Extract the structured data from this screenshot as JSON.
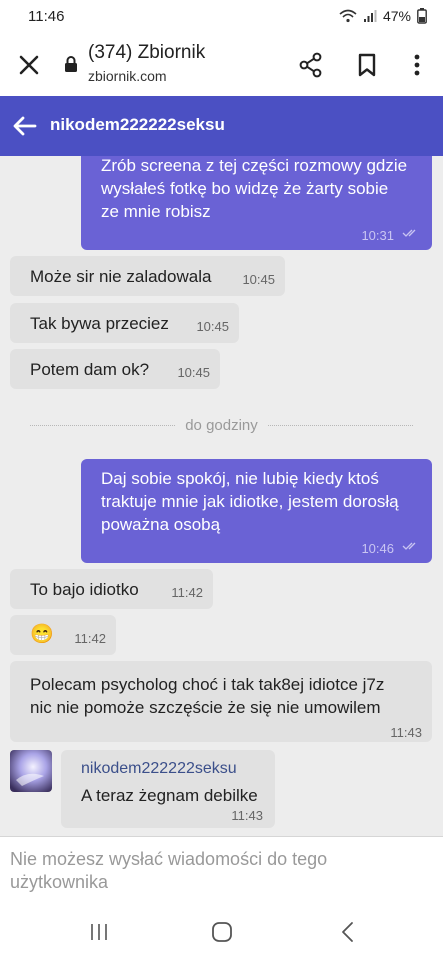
{
  "status_bar": {
    "time": "11:46",
    "battery": "47%"
  },
  "browser": {
    "tab_title": "(374) Zbiornik",
    "url": "zbiornik.com"
  },
  "chat": {
    "contact_name": "nikodem222222seksu"
  },
  "messages": [
    {
      "dir": "out",
      "lines": [
        "Zrób screena z tej części rozmowy gdzie",
        "wysłałeś fotkę bo widzę że żarty sobie",
        "ze mnie robisz"
      ],
      "time": "10:31"
    },
    {
      "dir": "in",
      "text": "Może sir nie zaladowala",
      "time": "10:45"
    },
    {
      "dir": "in",
      "text": "Tak bywa przeciez",
      "time": "10:45"
    },
    {
      "dir": "in",
      "text": "Potem dam ok?",
      "time": "10:45"
    },
    {
      "dir": "out",
      "lines": [
        "Daj sobie spokój, nie lubię kiedy ktoś",
        "traktuje mnie jak idiotke, jestem dorosłą",
        "poważna osobą"
      ],
      "time": "10:46"
    },
    {
      "dir": "in",
      "text": "To bajo idiotko",
      "time": "11:42"
    },
    {
      "dir": "in",
      "emoji": "😁",
      "time": "11:42"
    },
    {
      "dir": "in",
      "lines": [
        "Polecam psycholog choć i tak tak8ej idiotce j7z",
        "nic nie pomoże szczęście że się nie umowilem"
      ],
      "time": "11:43"
    }
  ],
  "separator_label": "do godziny",
  "quoted_message": {
    "sender": "nikodem222222seksu",
    "text": "A teraz żegnam debilke",
    "time": "11:43"
  },
  "compose": {
    "notice": "Nie możesz wysłać wiadomości do tego użytkownika"
  },
  "colors": {
    "header": "#4b50c3",
    "outgoing_bubble": "#6a62d5",
    "incoming_bubble": "#e1e1e1"
  },
  "icons": [
    "close-icon",
    "lock-icon",
    "share-icon",
    "bookmark-icon",
    "more-vert-icon",
    "arrow-back-icon",
    "double-check-icon",
    "recent-apps-icon",
    "home-icon",
    "back-nav-icon"
  ]
}
